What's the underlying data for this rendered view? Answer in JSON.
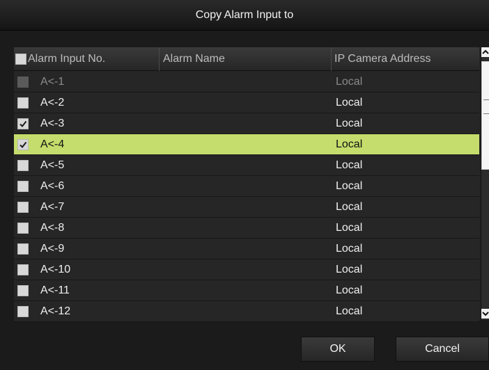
{
  "dialog": {
    "title": "Copy Alarm Input to"
  },
  "table": {
    "columns": [
      "Alarm Input No.",
      "Alarm Name",
      "IP Camera Address"
    ],
    "rows": [
      {
        "no": "A<-1",
        "name": "",
        "address": "Local",
        "checked": false,
        "disabled": true,
        "selected": false
      },
      {
        "no": "A<-2",
        "name": "",
        "address": "Local",
        "checked": false,
        "disabled": false,
        "selected": false
      },
      {
        "no": "A<-3",
        "name": "",
        "address": "Local",
        "checked": true,
        "disabled": false,
        "selected": false
      },
      {
        "no": "A<-4",
        "name": "",
        "address": "Local",
        "checked": true,
        "disabled": false,
        "selected": true
      },
      {
        "no": "A<-5",
        "name": "",
        "address": "Local",
        "checked": false,
        "disabled": false,
        "selected": false
      },
      {
        "no": "A<-6",
        "name": "",
        "address": "Local",
        "checked": false,
        "disabled": false,
        "selected": false
      },
      {
        "no": "A<-7",
        "name": "",
        "address": "Local",
        "checked": false,
        "disabled": false,
        "selected": false
      },
      {
        "no": "A<-8",
        "name": "",
        "address": "Local",
        "checked": false,
        "disabled": false,
        "selected": false
      },
      {
        "no": "A<-9",
        "name": "",
        "address": "Local",
        "checked": false,
        "disabled": false,
        "selected": false
      },
      {
        "no": "A<-10",
        "name": "",
        "address": "Local",
        "checked": false,
        "disabled": false,
        "selected": false
      },
      {
        "no": "A<-11",
        "name": "",
        "address": "Local",
        "checked": false,
        "disabled": false,
        "selected": false
      },
      {
        "no": "A<-12",
        "name": "",
        "address": "Local",
        "checked": false,
        "disabled": false,
        "selected": false
      }
    ]
  },
  "buttons": {
    "ok": "OK",
    "cancel": "Cancel"
  },
  "colors": {
    "selected_row": "#c5dd6c",
    "background": "#1b1b1b"
  },
  "icons": {
    "scroll_up": "chevron-up-icon",
    "scroll_down": "chevron-down-icon",
    "check": "checkmark-icon"
  }
}
